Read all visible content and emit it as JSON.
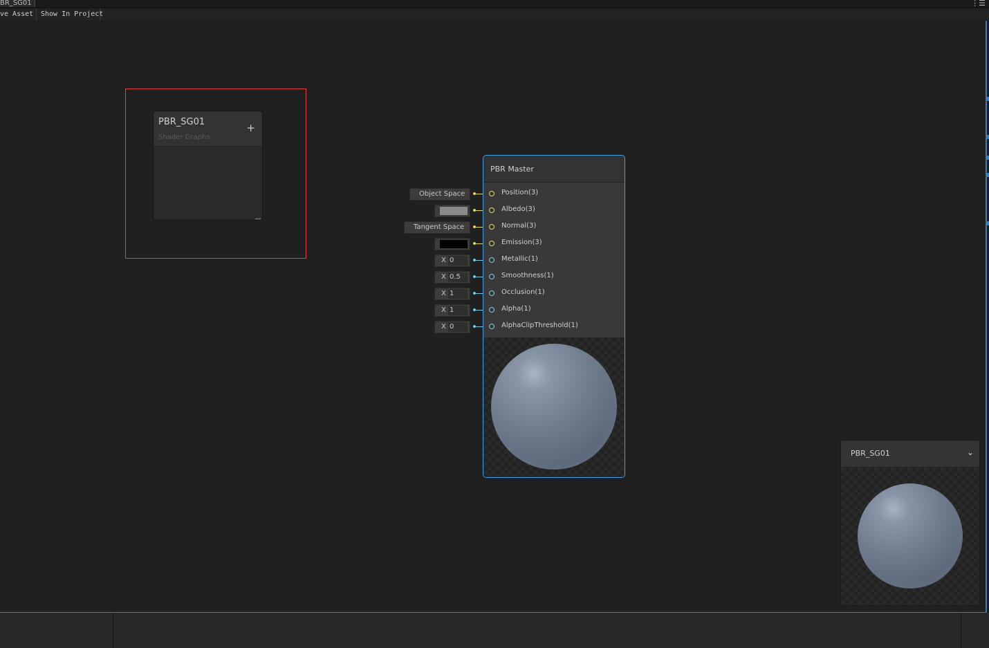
{
  "window": {
    "tab_title": "PBR_SG01",
    "menu_icon": "menu-icon"
  },
  "toolbar": {
    "save_label": "ve Asset",
    "show_label": "Show In Project"
  },
  "blackboard": {
    "title": "PBR_SG01",
    "subtitle": "Shader Graphs",
    "add_symbol": "+"
  },
  "master_node": {
    "title": "PBR Master",
    "ports": [
      {
        "label": "Position(3)",
        "type": "vector3"
      },
      {
        "label": "Albedo(3)",
        "type": "vector3"
      },
      {
        "label": "Normal(3)",
        "type": "vector3"
      },
      {
        "label": "Emission(3)",
        "type": "vector3"
      },
      {
        "label": "Metallic(1)",
        "type": "vector1"
      },
      {
        "label": "Smoothness(1)",
        "type": "vector1"
      },
      {
        "label": "Occlusion(1)",
        "type": "vector1"
      },
      {
        "label": "Alpha(1)",
        "type": "vector1"
      },
      {
        "label": "AlphaClipThreshold(1)",
        "type": "vector1"
      }
    ],
    "inputs": [
      {
        "kind": "space",
        "value": "Object Space"
      },
      {
        "kind": "color",
        "value": "#8a8a8a"
      },
      {
        "kind": "space",
        "value": "Tangent Space"
      },
      {
        "kind": "color",
        "value": "#000000"
      },
      {
        "kind": "number",
        "axis": "X",
        "value": "0"
      },
      {
        "kind": "number",
        "axis": "X",
        "value": "0.5"
      },
      {
        "kind": "number",
        "axis": "X",
        "value": "1"
      },
      {
        "kind": "number",
        "axis": "X",
        "value": "1"
      },
      {
        "kind": "number",
        "axis": "X",
        "value": "0"
      }
    ]
  },
  "main_preview": {
    "title": "PBR_SG01",
    "chevron": "⌄"
  },
  "colors": {
    "vector3_port": "#dcd668",
    "vector1_port": "#7fc5e2",
    "selection": "#45a0e6",
    "group_border": "#e04040"
  }
}
